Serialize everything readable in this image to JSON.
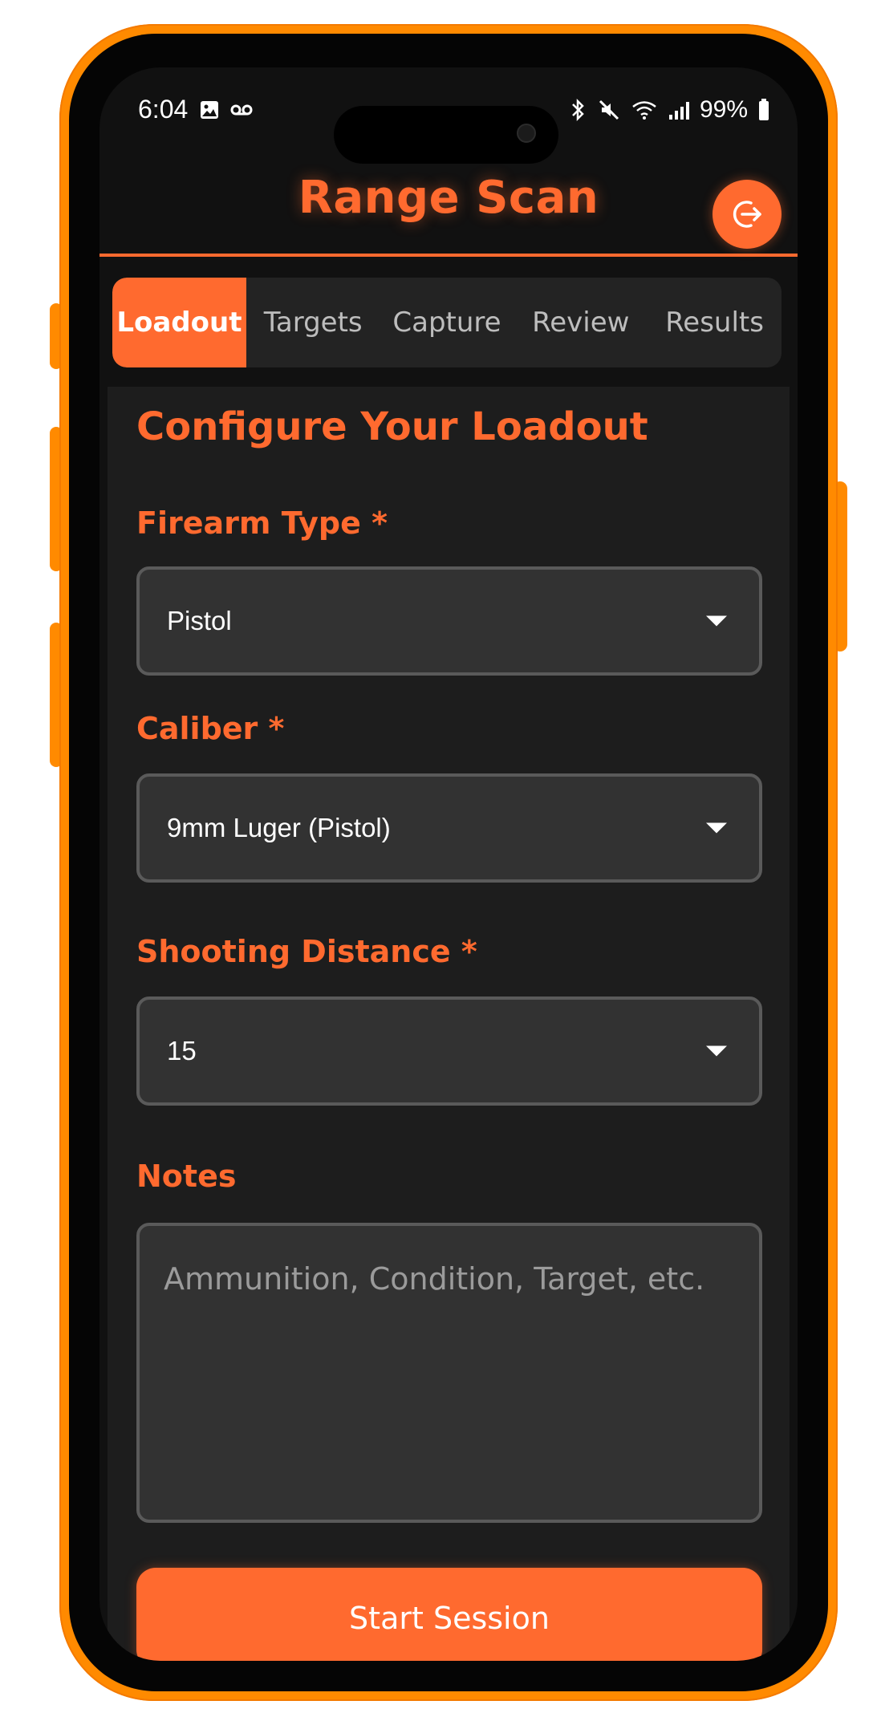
{
  "status_bar": {
    "time": "6:04",
    "battery": "99%"
  },
  "header": {
    "title": "Range Scan"
  },
  "tabs": [
    {
      "label": "Loadout"
    },
    {
      "label": "Targets"
    },
    {
      "label": "Capture"
    },
    {
      "label": "Review"
    },
    {
      "label": "Results"
    }
  ],
  "main": {
    "section_title": "Configure Your Loadout",
    "firearm_type": {
      "label": "Firearm Type *",
      "value": "Pistol"
    },
    "caliber": {
      "label": "Caliber *",
      "value": "9mm Luger (Pistol)"
    },
    "distance": {
      "label": "Shooting Distance *",
      "value": "15"
    },
    "notes": {
      "label": "Notes",
      "placeholder": "Ammunition, Condition, Target, etc."
    },
    "start_button": "Start Session"
  },
  "colors": {
    "accent": "#ff6a2f",
    "frame": "#ff8a00",
    "background": "#1d1d1d",
    "field": "#323232"
  },
  "icons": {
    "logout": "logout-icon",
    "dropdown": "chevron-down-icon"
  }
}
